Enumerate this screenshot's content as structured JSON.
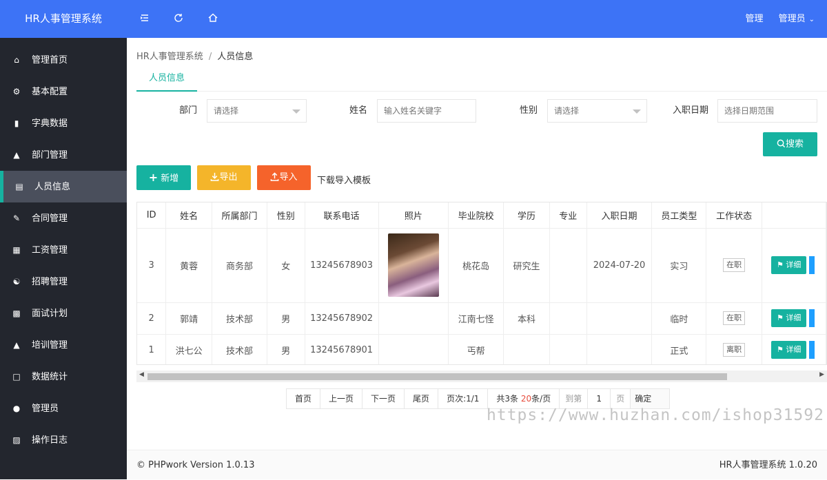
{
  "header": {
    "brand": "HR人事管理系统",
    "right_link": "管理",
    "user": "管理员"
  },
  "sidebar": {
    "items": [
      {
        "label": "管理首页",
        "icon": "home-icon"
      },
      {
        "label": "基本配置",
        "icon": "gear-icon"
      },
      {
        "label": "字典数据",
        "icon": "book-icon"
      },
      {
        "label": "部门管理",
        "icon": "sitemap-icon"
      },
      {
        "label": "人员信息",
        "icon": "id-card-icon"
      },
      {
        "label": "合同管理",
        "icon": "edit-icon"
      },
      {
        "label": "工资管理",
        "icon": "calculator-icon"
      },
      {
        "label": "招聘管理",
        "icon": "handshake-icon"
      },
      {
        "label": "面试计划",
        "icon": "clipboard-icon"
      },
      {
        "label": "培训管理",
        "icon": "graduation-icon"
      },
      {
        "label": "数据统计",
        "icon": "chart-icon"
      },
      {
        "label": "管理员",
        "icon": "user-icon"
      },
      {
        "label": "操作日志",
        "icon": "log-icon"
      }
    ],
    "active_index": 4
  },
  "breadcrumb": {
    "root": "HR人事管理系统",
    "sep": "/",
    "current": "人员信息"
  },
  "tab": {
    "label": "人员信息"
  },
  "filters": {
    "dept_label": "部门",
    "dept_placeholder": "请选择",
    "name_label": "姓名",
    "name_placeholder": "输入姓名关键字",
    "gender_label": "性别",
    "gender_placeholder": "请选择",
    "date_label": "入职日期",
    "date_placeholder": "选择日期范围"
  },
  "buttons": {
    "search": "搜索",
    "add": "新增",
    "export": "导出",
    "import": "导入",
    "template": "下载导入模板",
    "detail": "详细"
  },
  "table": {
    "columns": [
      "ID",
      "姓名",
      "所属部门",
      "性别",
      "联系电话",
      "照片",
      "毕业院校",
      "学历",
      "专业",
      "入职日期",
      "员工类型",
      "工作状态",
      ""
    ],
    "rows": [
      [
        "3",
        "黄蓉",
        "商务部",
        "女",
        "13245678903",
        "",
        "桃花岛",
        "研究生",
        "",
        "2024-07-20",
        "实习",
        "在职"
      ],
      [
        "2",
        "郭靖",
        "技术部",
        "男",
        "13245678902",
        "",
        "江南七怪",
        "本科",
        "",
        "",
        "临时",
        "在职"
      ],
      [
        "1",
        "洪七公",
        "技术部",
        "男",
        "13245678901",
        "",
        "丐帮",
        "",
        "",
        "",
        "正式",
        "离职"
      ]
    ]
  },
  "pager": {
    "first": "首页",
    "prev": "上一页",
    "next": "下一页",
    "last": "尾页",
    "pages": "页次:1/1",
    "total_prefix": "共3条",
    "per_page_num": "20",
    "per_page_suffix": "条/页",
    "goto": "到第",
    "page_num": "1",
    "page_unit": "页",
    "confirm": "确定"
  },
  "footer": {
    "left": "© PHPwork Version 1.0.13",
    "right": "HR人事管理系统 1.0.20"
  },
  "watermark": "https://www.huzhan.com/ishop31592",
  "colors": {
    "header": "#3d73f6",
    "sidebar": "#23262e",
    "teal": "#16b2a0",
    "orange": "#f4b52a",
    "red": "#f5632b"
  }
}
